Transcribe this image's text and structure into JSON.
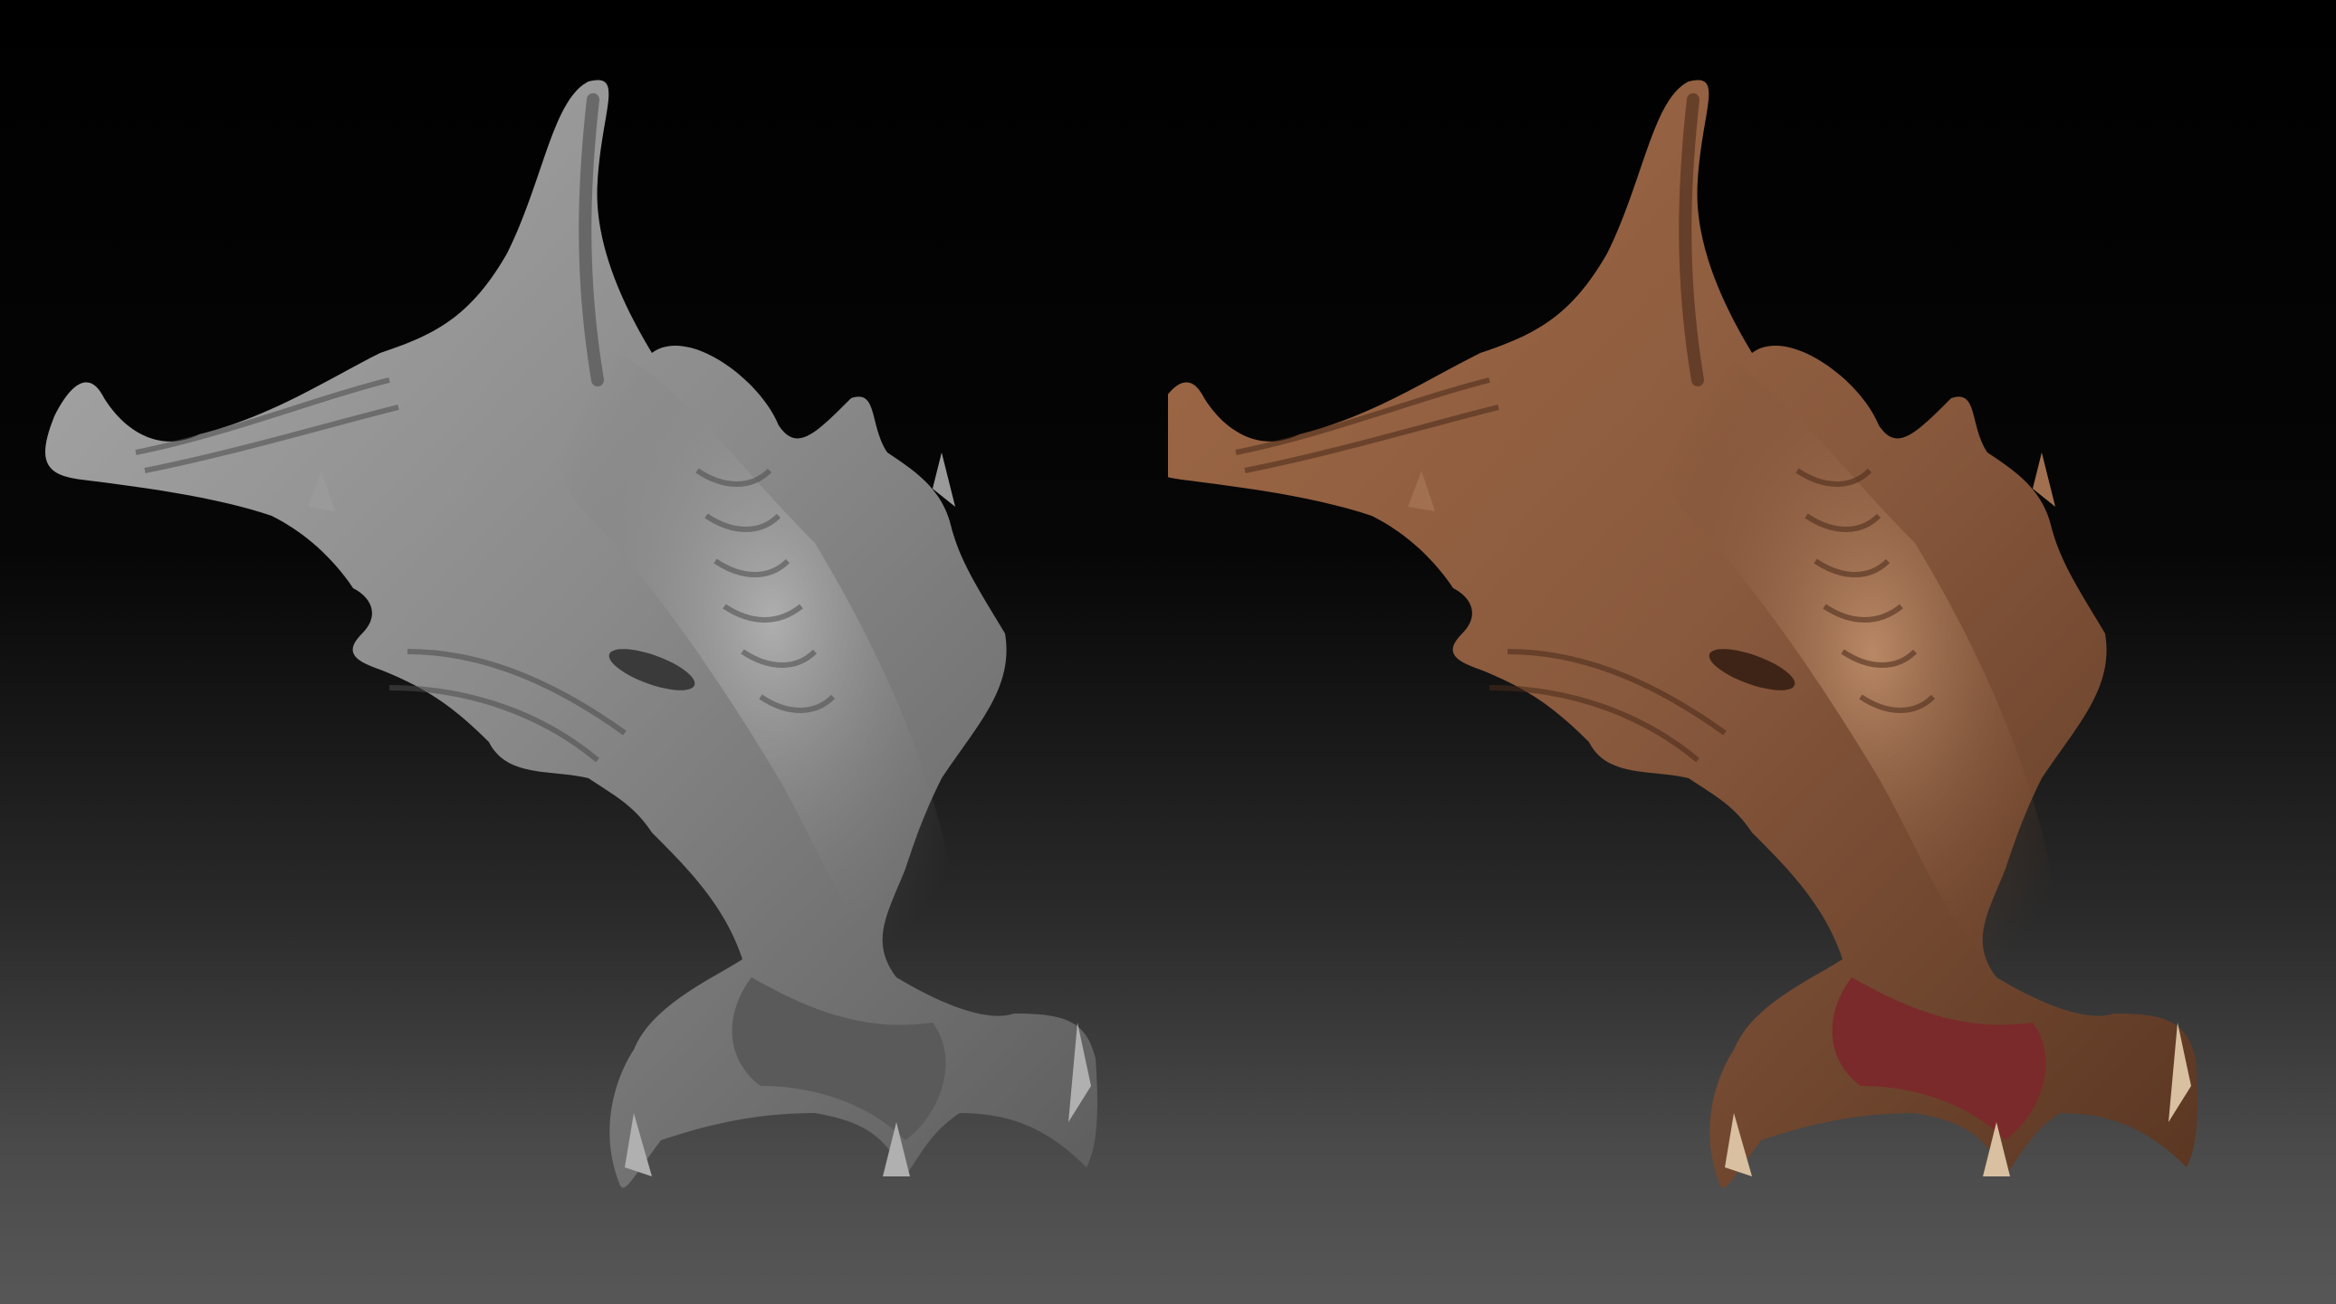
{
  "scene": {
    "description_visible_text": "",
    "panels": [
      {
        "id": "sculpt",
        "material": "grey-clay",
        "colors": {
          "base": "#8a8a8a",
          "light": "#b8b8b8",
          "dark": "#3a3a3a",
          "mouth": "#5a5a5a"
        }
      },
      {
        "id": "painted",
        "material": "painted-skin",
        "colors": {
          "base": "#8a5a3e",
          "light": "#c9956a",
          "dark": "#3e2416",
          "mouth": "#7a2a2a"
        }
      }
    ],
    "background": {
      "top": "#000000",
      "bottom": "#575757"
    }
  }
}
